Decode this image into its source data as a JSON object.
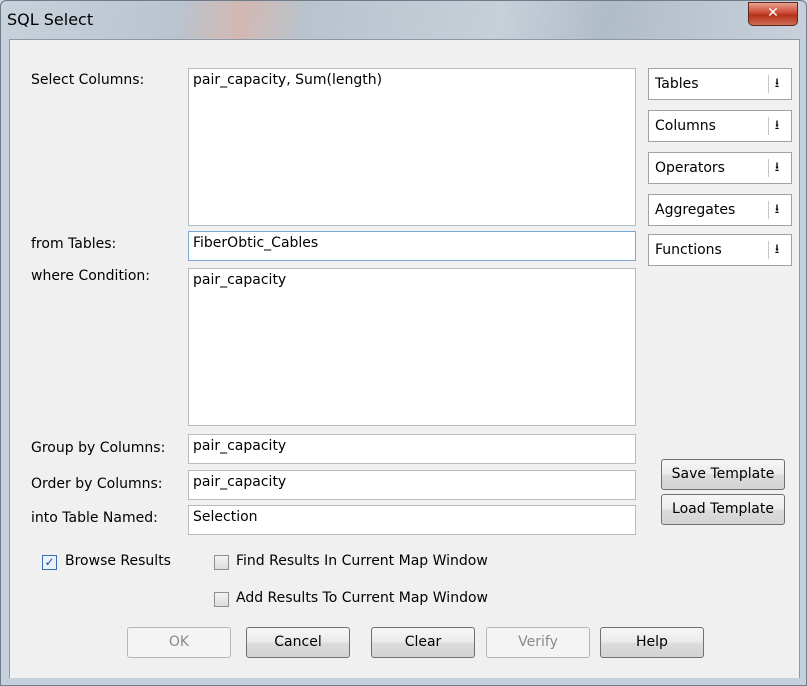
{
  "window": {
    "title": "SQL Select",
    "close_icon": "close-icon"
  },
  "labels": {
    "select_columns": "Select Columns:",
    "from_tables": "from Tables:",
    "where_condition": "where Condition:",
    "group_by": "Group by Columns:",
    "order_by": "Order by Columns:",
    "into_table": "into Table Named:"
  },
  "fields": {
    "select_columns": "pair_capacity, Sum(length)",
    "from_tables": "FiberObtic_Cables",
    "where_condition": "pair_capacity",
    "group_by": "pair_capacity",
    "order_by": "pair_capacity",
    "into_table": "Selection"
  },
  "dropdowns": [
    {
      "label": "Tables",
      "icon": "chevron-down-icon"
    },
    {
      "label": "Columns",
      "icon": "chevron-down-icon"
    },
    {
      "label": "Operators",
      "icon": "chevron-down-icon"
    },
    {
      "label": "Aggregates",
      "icon": "chevron-down-icon"
    },
    {
      "label": "Functions",
      "icon": "chevron-down-icon"
    }
  ],
  "template_buttons": {
    "save": "Save Template",
    "load": "Load Template"
  },
  "checkboxes": {
    "browse_results": {
      "label": "Browse Results",
      "checked": true
    },
    "find_results": {
      "label": "Find Results In Current Map Window",
      "checked": false
    },
    "add_results": {
      "label": "Add Results To Current Map Window",
      "checked": false
    }
  },
  "buttons": {
    "ok": "OK",
    "cancel": "Cancel",
    "clear": "Clear",
    "verify": "Verify",
    "help": "Help"
  },
  "colors": {
    "close_button": "#c9452c",
    "dialog_bg": "#f0f0f0",
    "focus_border": "#7aa7d6"
  }
}
